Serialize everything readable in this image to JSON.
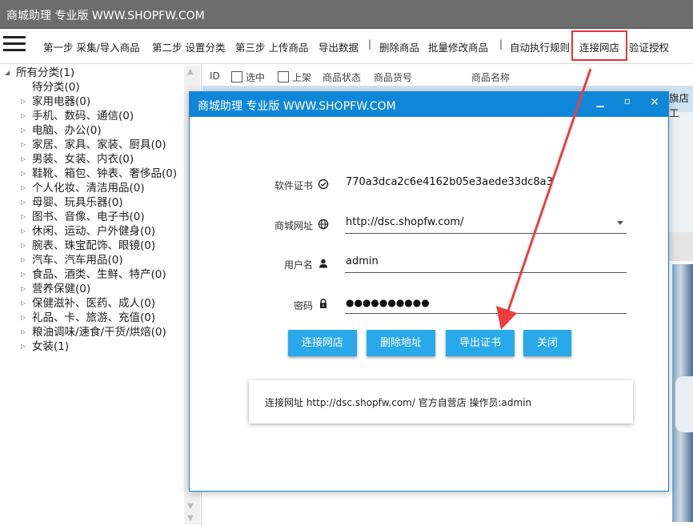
{
  "window": {
    "title": "商城助理 专业版 WWW.SHOPFW.COM"
  },
  "toolbar": {
    "items": [
      "第一步 采集/导入商品",
      "第二步 设置分类",
      "第三步 上传商品",
      "导出数据",
      "|",
      "删除商品",
      "批量修改商品",
      "|",
      "自动执行规则",
      "连接网店",
      "验证授权"
    ]
  },
  "tree": {
    "root": "所有分类(1)",
    "items": [
      "待分类(0)",
      "家用电器(0)",
      "手机、数码、通信(0)",
      "电脑、办公(0)",
      "家居、家具、家装、厨具(0)",
      "男装、女装、内衣(0)",
      "鞋靴、箱包、钟表、奢侈品(0)",
      "个人化妆、清洁用品(0)",
      "母婴、玩具乐器(0)",
      "图书、音像、电子书(0)",
      "休闲、运动、户外健身(0)",
      "腕表、珠宝配饰、眼镜(0)",
      "汽车、汽车用品(0)",
      "食品、酒类、生鲜、特产(0)",
      "营养保健(0)",
      "保健滋补、医药、成人(0)",
      "礼品、卡、旅游、充值(0)",
      "粮油调味/速食/干货/烘焙(0)",
      "女装(1)"
    ]
  },
  "grid": {
    "headers": [
      "ID",
      "选中",
      "上架",
      "商品状态",
      "商品货号",
      "商品名称"
    ],
    "row_fragment": "旗店工"
  },
  "dialog": {
    "title": "商城助理 专业版 WWW.SHOPFW.COM",
    "fields": {
      "license": {
        "label": "软件证书",
        "value": "770a3dca2c6e4162b05e3aede33dc8a3"
      },
      "url": {
        "label": "商城网址",
        "value": "http://dsc.shopfw.com/"
      },
      "username": {
        "label": "用户名",
        "value": "admin"
      },
      "password": {
        "label": "密码",
        "value": "●●●●●●●●●●"
      }
    },
    "buttons": {
      "connect": "连接网店",
      "delete": "删除地址",
      "export": "导出证书",
      "close": "关闭"
    },
    "status": "连接网址 http://dsc.shopfw.com/ 官方自营店 操作员:admin"
  },
  "colors": {
    "accent": "#0f87d8",
    "button": "#29a8ea",
    "highlight": "#e8323a",
    "titlebar": "#6d6d6d"
  },
  "icons": [
    "menu-icon",
    "check-circle-icon",
    "globe-icon",
    "user-icon",
    "lock-icon",
    "minimize-icon",
    "maximize-icon",
    "close-icon"
  ]
}
